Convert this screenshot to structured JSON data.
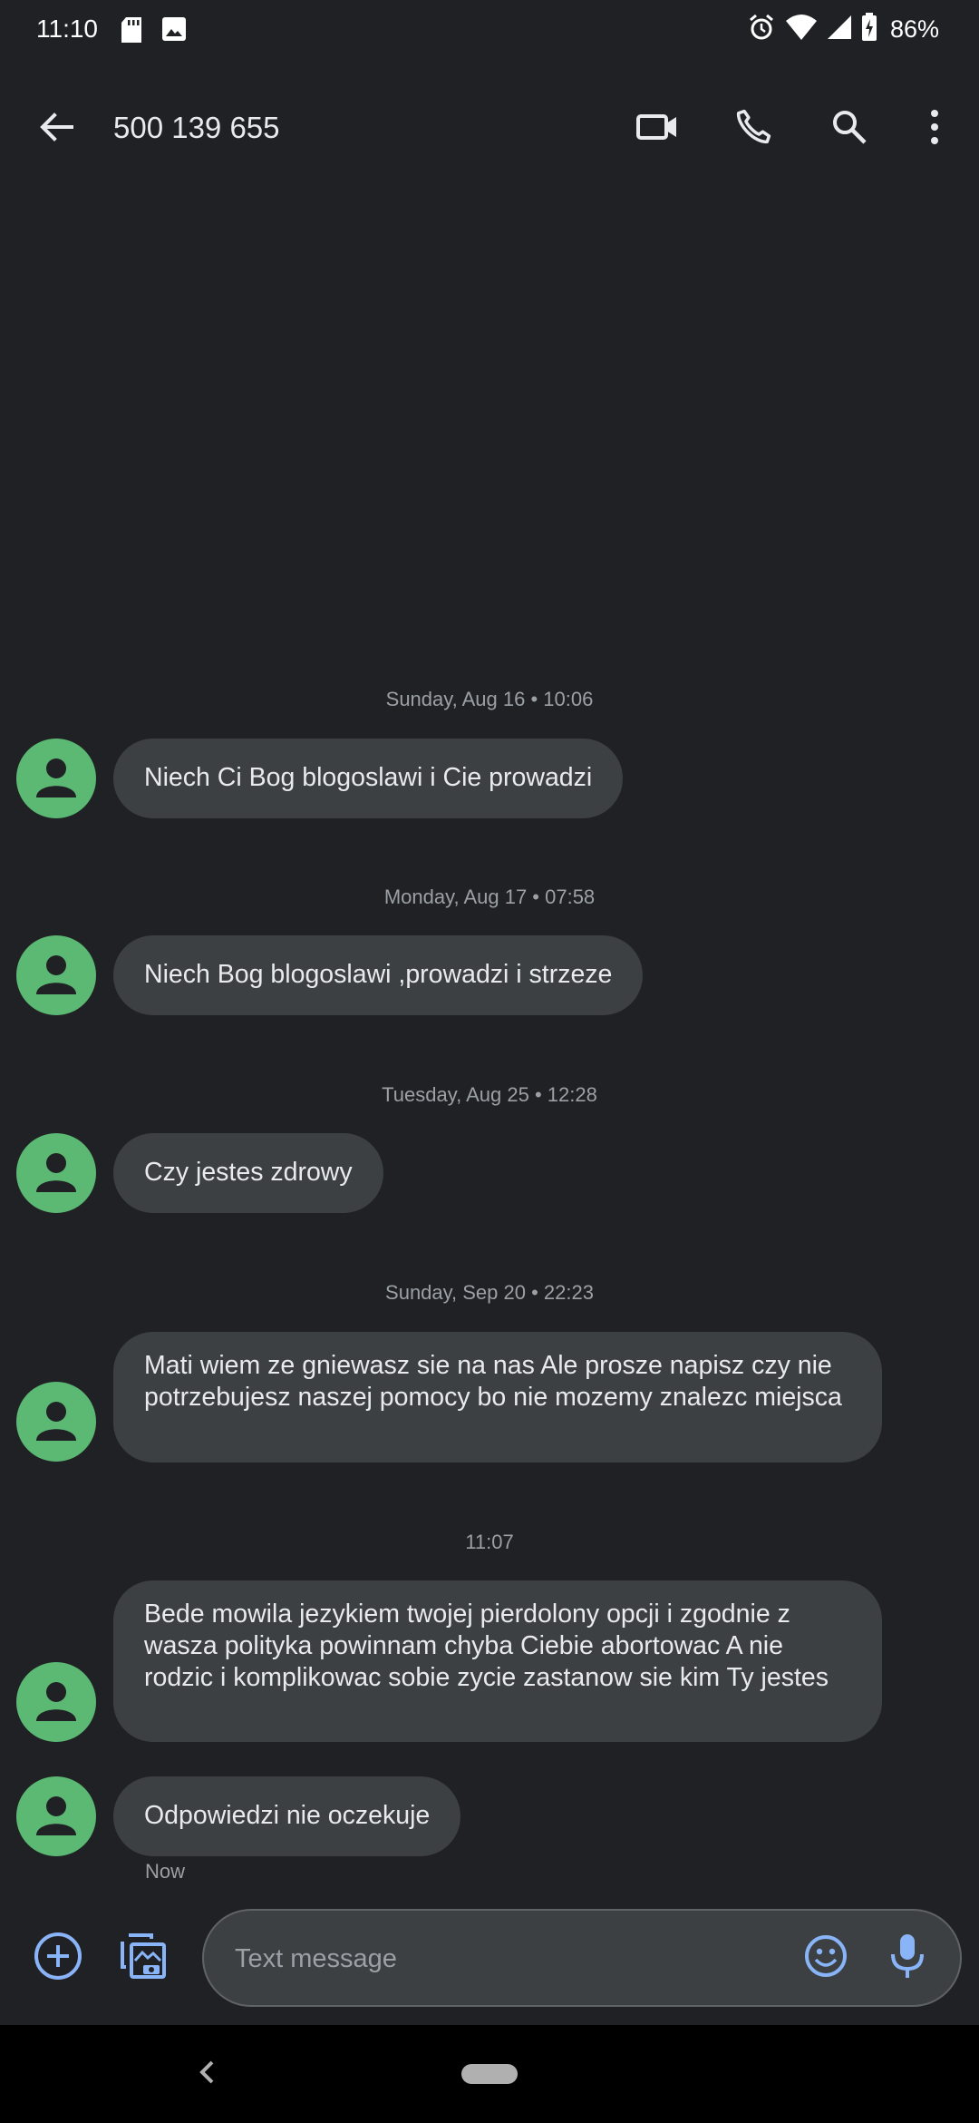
{
  "status_bar": {
    "time": "11:10",
    "battery": "86%"
  },
  "header": {
    "title": "500 139 655"
  },
  "conversation": [
    {
      "date": "Sunday, Aug 16 • 10:06",
      "message": "Niech Ci  Bog blogoslawi i  Cie  prowadzi"
    },
    {
      "date": "Monday, Aug 17 • 07:58",
      "message": "Niech Bog  blogoslawi ,prowadzi i strzeze"
    },
    {
      "date": "Tuesday, Aug 25 • 12:28",
      "message": "Czy jestes  zdrowy"
    },
    {
      "date": "Sunday, Sep 20 • 22:23",
      "message": "Mati wiem ze gniewasz sie na nas Ale prosze napisz czy nie potrzebujesz naszej pomocy bo nie mozemy znalezc miejsca"
    },
    {
      "date": "11:07",
      "message": "Bede mowila jezykiem twojej pierdolony opcji i zgodnie z wasza polityka powinnam chyba Ciebie abortowac A nie rodzic i komplikowac sobie zycie  zastanow sie kim Ty jestes"
    },
    {
      "message": "Odpowiedzi nie oczekuje",
      "status": "Now"
    }
  ],
  "compose": {
    "placeholder": "Text message",
    "value": ""
  },
  "colors": {
    "background": "#202124",
    "bubble": "#3c4043",
    "avatar": "#5bb974",
    "accent": "#8ab4f8",
    "muted_text": "#9aa0a6"
  },
  "icons": [
    "back-arrow-icon",
    "video-call-icon",
    "phone-icon",
    "search-icon",
    "more-vert-icon",
    "add-circle-icon",
    "gallery-icon",
    "emoji-icon",
    "microphone-icon",
    "person-icon"
  ]
}
